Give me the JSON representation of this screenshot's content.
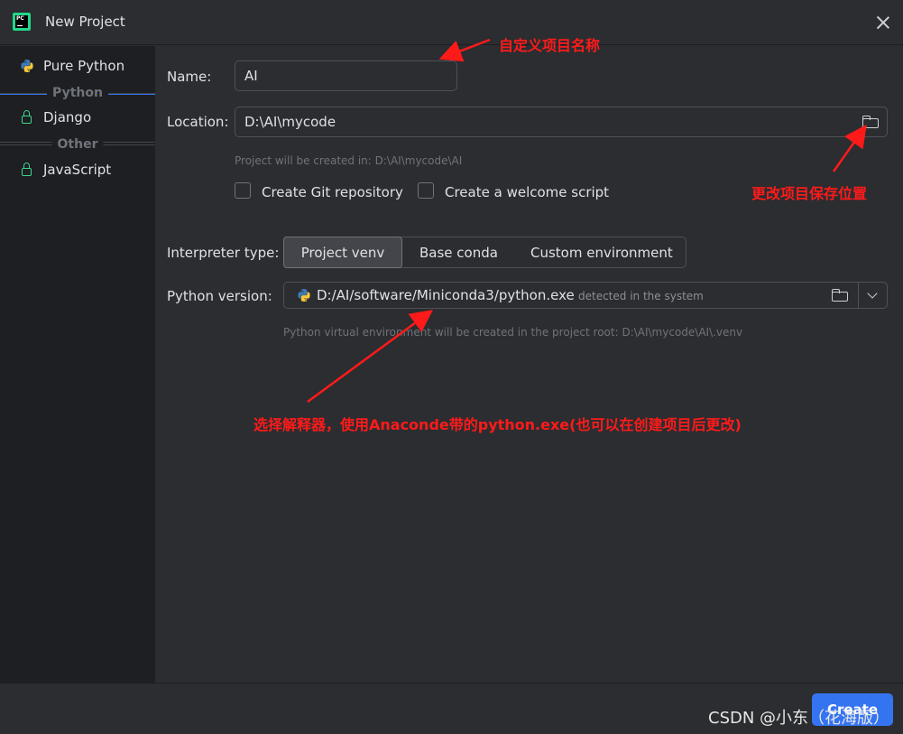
{
  "window": {
    "title": "New Project"
  },
  "sidebar": {
    "items": [
      {
        "label": "Pure Python"
      },
      {
        "label": "Django"
      },
      {
        "label": "JavaScript"
      }
    ],
    "groups": [
      "Python",
      "Other"
    ]
  },
  "form": {
    "name_label": "Name:",
    "name_value": "AI",
    "location_label": "Location:",
    "location_value": "D:\\AI\\mycode",
    "location_hint": "Project will be created in: D:\\AI\\mycode\\AI",
    "git_label": "Create Git repository",
    "welcome_label": "Create a welcome script",
    "interpreter_label": "Interpreter type:",
    "interpreter_options": [
      "Project venv",
      "Base conda",
      "Custom environment"
    ],
    "python_version_label": "Python version:",
    "python_path": "D:/AI/software/Miniconda3/python.exe",
    "python_detected": "detected in the system",
    "venv_hint": "Python virtual environment will be created in the project root: D:\\AI\\mycode\\AI\\.venv"
  },
  "footer": {
    "create_label": "Create",
    "watermark": "CSDN @小东（花海版）"
  },
  "annotations": {
    "name": "自定义项目名称",
    "location": "更改项目保存位置",
    "interpreter": "选择解释器，使用Anaconde带的python.exe(也可以在创建项目后更改)"
  },
  "colors": {
    "accent": "#3574f0",
    "annotation": "#ff1a1a",
    "lock": "#3dd68c"
  }
}
